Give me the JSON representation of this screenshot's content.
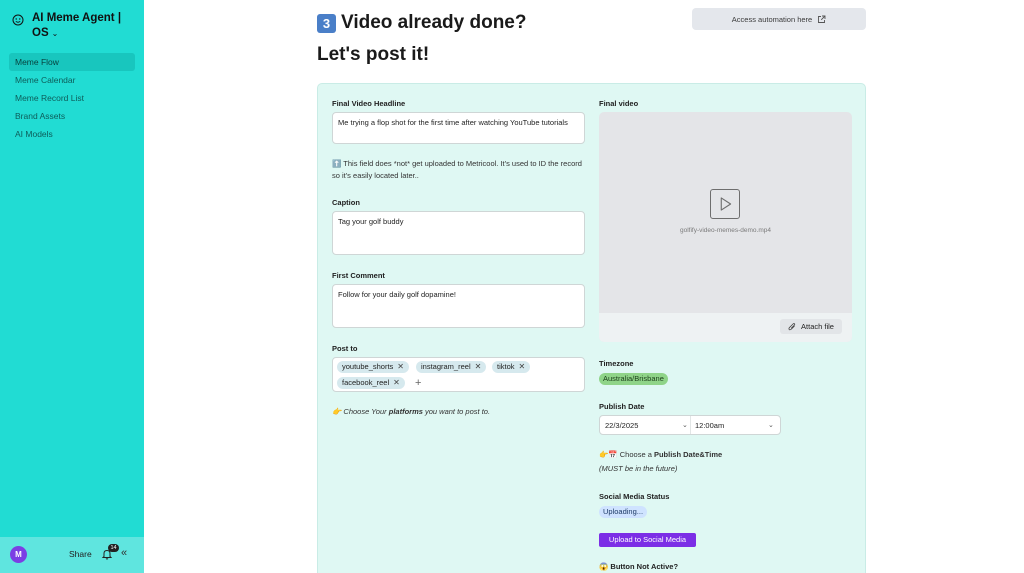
{
  "sidebar": {
    "brand_title": "AI Meme Agent |",
    "brand_subtitle": "OS",
    "brand_chevron": "⌄",
    "items": [
      {
        "label": "Meme Flow",
        "active": true
      },
      {
        "label": "Meme Calendar",
        "active": false
      },
      {
        "label": "Meme Record List",
        "active": false
      },
      {
        "label": "Brand Assets",
        "active": false
      },
      {
        "label": "AI Models",
        "active": false
      }
    ],
    "footer": {
      "avatar_initial": "M",
      "share_label": "Share",
      "notification_count": "14",
      "collapse_glyph": "«"
    }
  },
  "header": {
    "step_number": "3",
    "title_line1": "Video already done?",
    "title_line2": "Let's post it!",
    "automation_button": "Access automation here"
  },
  "form": {
    "headline": {
      "label": "Final Video Headline",
      "value": "Me trying a flop shot for the first time after watching YouTube tutorials"
    },
    "headline_note": "⬆️ This field does *not* get uploaded to Metricool. It's used to ID the record so it's easily located later..",
    "caption": {
      "label": "Caption",
      "value": "Tag your golf buddy"
    },
    "first_comment": {
      "label": "First Comment",
      "value": "Follow for your daily golf dopamine!"
    },
    "post_to": {
      "label": "Post to",
      "chips": [
        "youtube_shorts",
        "instagram_reel",
        "tiktok",
        "facebook_reel"
      ],
      "add_glyph": "+"
    },
    "post_to_note_prefix": "👉 Choose Your ",
    "post_to_note_bold": "platforms",
    "post_to_note_suffix": " you want to post to.",
    "final_video": {
      "label": "Final video",
      "filename": "golfify-video-memes-demo.mp4",
      "attach_label": "Attach file"
    },
    "timezone": {
      "label": "Timezone",
      "value": "Australia/Brisbane"
    },
    "publish_date": {
      "label": "Publish Date",
      "date": "22/3/2025",
      "time": "12:00am"
    },
    "publish_note_prefix": "👉📅 Choose a ",
    "publish_note_bold": "Publish Date&Time",
    "publish_note_line2": "(MUST be in the future)",
    "social_status": {
      "label": "Social Media Status",
      "value": "Uploading..."
    },
    "upload_button": "Upload to Social Media",
    "button_not_active": "😱 Button Not Active?"
  },
  "colors": {
    "sidebar_bg": "#21dcd3",
    "card_bg": "#dff8f3",
    "upload_button": "#7c2ee6",
    "timezone_chip": "#8fd488",
    "status_chip": "#cfe3ff"
  }
}
